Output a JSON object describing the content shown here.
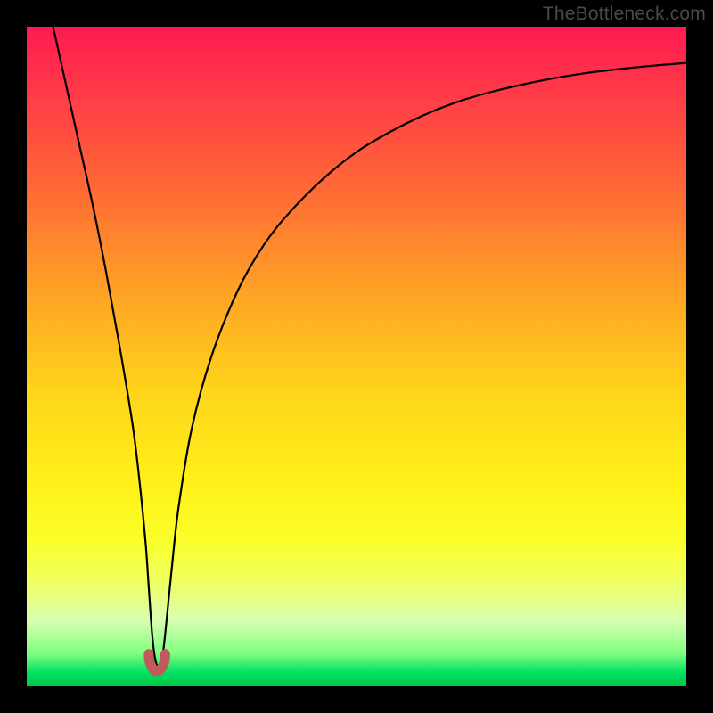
{
  "watermark": "TheBottleneck.com",
  "chart_data": {
    "type": "line",
    "title": "",
    "xlabel": "",
    "ylabel": "",
    "xlim": [
      0,
      100
    ],
    "ylim": [
      0,
      100
    ],
    "x": [
      4,
      6,
      8,
      10,
      12,
      14,
      16,
      17,
      18,
      18.5,
      19,
      19.5,
      20,
      20.5,
      21,
      22,
      23,
      25,
      28,
      32,
      36,
      40,
      45,
      50,
      55,
      60,
      65,
      70,
      75,
      80,
      85,
      90,
      95,
      100
    ],
    "values": [
      100,
      91,
      82,
      73,
      63,
      52,
      40,
      32,
      22,
      15,
      8,
      4,
      3,
      4,
      8,
      18,
      27,
      39,
      50,
      60,
      67,
      72,
      77,
      81,
      84,
      86.5,
      88.5,
      90,
      91.2,
      92.2,
      93,
      93.6,
      94.1,
      94.5
    ],
    "min_marker": {
      "x_range": [
        18.5,
        21
      ],
      "y": 3,
      "color": "#c15a5a"
    },
    "grid": false,
    "annotations": []
  },
  "colors": {
    "curve": "#000000",
    "marker": "#c15a5a",
    "background_top": "#ff1a52",
    "background_bottom": "#00c84a",
    "frame": "#000000"
  }
}
